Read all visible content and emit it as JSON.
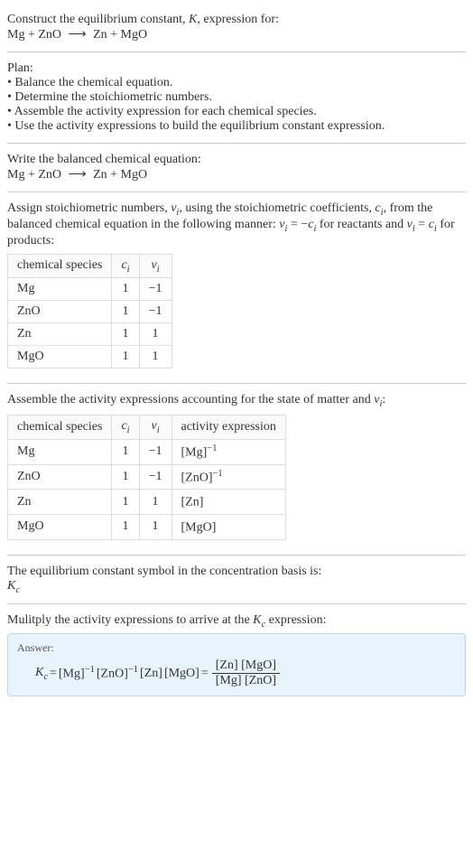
{
  "header": {
    "line1_prefix": "Construct the equilibrium constant, ",
    "line1_K": "K",
    "line1_suffix": ", expression for:",
    "eq_lhs": "Mg + ZnO",
    "eq_arrow": "⟶",
    "eq_rhs": "Zn + MgO"
  },
  "plan": {
    "title": "Plan:",
    "b1": "• Balance the chemical equation.",
    "b2": "• Determine the stoichiometric numbers.",
    "b3": "• Assemble the activity expression for each chemical species.",
    "b4": "• Use the activity expressions to build the equilibrium constant expression."
  },
  "balanced": {
    "title": "Write the balanced chemical equation:",
    "eq_lhs": "Mg + ZnO",
    "eq_arrow": "⟶",
    "eq_rhs": "Zn + MgO"
  },
  "stoich": {
    "text_a": "Assign stoichiometric numbers, ",
    "nu": "ν",
    "text_b": ", using the stoichiometric coefficients, ",
    "c": "c",
    "text_c": ", from the balanced chemical equation in the following manner: ",
    "rel1_a": "ν",
    "rel1_b": " = −",
    "rel1_c": "c",
    "text_d": " for reactants and ",
    "rel2_a": "ν",
    "rel2_b": " = ",
    "rel2_c": "c",
    "text_e": " for products:",
    "headers": {
      "sp": "chemical species",
      "ci": "c",
      "nui": "ν"
    },
    "rows": [
      {
        "sp": "Mg",
        "ci": "1",
        "nui": "−1"
      },
      {
        "sp": "ZnO",
        "ci": "1",
        "nui": "−1"
      },
      {
        "sp": "Zn",
        "ci": "1",
        "nui": "1"
      },
      {
        "sp": "MgO",
        "ci": "1",
        "nui": "1"
      }
    ]
  },
  "activity": {
    "text_a": "Assemble the activity expressions accounting for the state of matter and ",
    "nu": "ν",
    "text_b": ":",
    "headers": {
      "sp": "chemical species",
      "ci": "c",
      "nui": "ν",
      "ae": "activity expression"
    },
    "rows": [
      {
        "sp": "Mg",
        "ci": "1",
        "nui": "−1",
        "base": "[Mg]",
        "exp": "−1"
      },
      {
        "sp": "ZnO",
        "ci": "1",
        "nui": "−1",
        "base": "[ZnO]",
        "exp": "−1"
      },
      {
        "sp": "Zn",
        "ci": "1",
        "nui": "1",
        "base": "[Zn]",
        "exp": ""
      },
      {
        "sp": "MgO",
        "ci": "1",
        "nui": "1",
        "base": "[MgO]",
        "exp": ""
      }
    ]
  },
  "kc_symbol": {
    "text": "The equilibrium constant symbol in the concentration basis is:",
    "sym": "K",
    "sub": "c"
  },
  "multiply": {
    "text_a": "Mulitply the activity expressions to arrive at the ",
    "K": "K",
    "sub": "c",
    "text_b": " expression:"
  },
  "answer": {
    "label": "Answer:",
    "K": "K",
    "sub": "c",
    "eq": " = ",
    "t1_base": "[Mg]",
    "t1_exp": "−1",
    "t2_base": "[ZnO]",
    "t2_exp": "−1",
    "t3": "[Zn]",
    "t4": "[MgO]",
    "eq2": " = ",
    "num": "[Zn] [MgO]",
    "den": "[Mg] [ZnO]"
  },
  "i": "i"
}
